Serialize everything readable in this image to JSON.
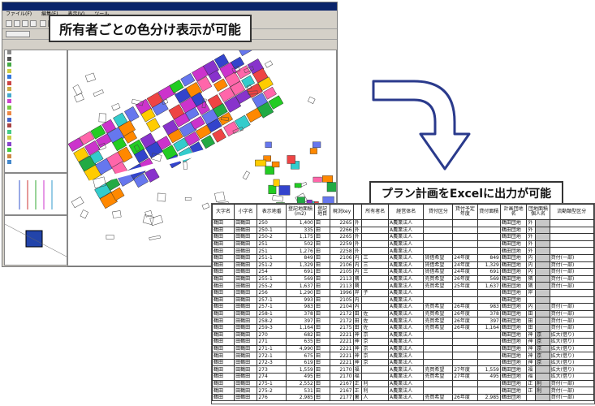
{
  "callouts": {
    "owner_color": "所有者ごとの色分け表示が可能",
    "excel_output": "プラン計画をExcelに出力が可能"
  },
  "gis": {
    "menu": [
      "ファイル(F)",
      "編集(E)",
      "表示(V)",
      "ツール"
    ],
    "colors": {
      "map_fill": [
        "#3344cc",
        "#22aa44",
        "#cc33cc",
        "#ee4444",
        "#ffcc00",
        "#33cccc",
        "#ff8800",
        "#8833cc",
        "#22cc22",
        "#ff66aa",
        "#6677ee"
      ],
      "river": "#ffffff",
      "outline": "#333333"
    }
  },
  "sheet": {
    "headers": [
      "大字名",
      "小字名",
      "表示地番",
      "登記地面積(m2)",
      "登記地目",
      "現況key",
      "所有者名",
      "経営体名",
      "貸付区分",
      "貸付予定年度",
      "貸付面積",
      "計画団地名",
      "団地面積個人名",
      "流動類型区分"
    ],
    "rows": [
      [
        "鶴田",
        "田鶴田",
        "250",
        "1,400",
        "田",
        "2265",
        "外",
        "",
        "A農業法人",
        "",
        "",
        "",
        "鶴田団地",
        "外",
        "",
        ""
      ],
      [
        "鶴田",
        "田鶴田",
        "250-1",
        "335",
        "田",
        "2266",
        "外",
        "",
        "A農業法人",
        "",
        "",
        "",
        "鶴田団地",
        "外",
        "",
        ""
      ],
      [
        "鶴田",
        "田鶴田",
        "250-2",
        "1,175",
        "田",
        "2265",
        "外",
        "",
        "A農業法人",
        "",
        "",
        "",
        "鶴田団地",
        "外",
        "",
        ""
      ],
      [
        "鶴田",
        "田鶴田",
        "251",
        "502",
        "田",
        "2259",
        "外",
        "",
        "A農業法人",
        "",
        "",
        "",
        "鶴田団地",
        "外",
        "",
        ""
      ],
      [
        "鶴田",
        "田鶴田",
        "251",
        "1,276",
        "田",
        "2258",
        "外",
        "",
        "A農業法人",
        "",
        "",
        "",
        "鶴田団地",
        "外",
        "",
        ""
      ],
      [
        "鶴田",
        "田鶴田",
        "251-1",
        "849",
        "田",
        "2106",
        "内",
        "三",
        "A農業法人",
        "賃借希望",
        "24年度",
        "849",
        "鶴田団地",
        "内",
        "",
        "貸付(一部)"
      ],
      [
        "鶴田",
        "田鶴田",
        "251-2",
        "1,329",
        "田",
        "2106",
        "内",
        "三",
        "A農業法人",
        "賃借希望",
        "24年度",
        "1,329",
        "鶴田団地",
        "内",
        "",
        "貸付(一部)"
      ],
      [
        "鶴田",
        "田鶴田",
        "254",
        "691",
        "田",
        "2105",
        "内",
        "三",
        "A農業法人",
        "賃借希望",
        "24年度",
        "691",
        "鶴田団地",
        "内",
        "",
        "貸付(一部)"
      ],
      [
        "鶴田",
        "田鶴田",
        "255-1",
        "569",
        "田",
        "2113",
        "隣",
        "",
        "A農業法人",
        "売買希望",
        "26年度",
        "569",
        "鶴田団地",
        "隣",
        "",
        "貸付(一部)"
      ],
      [
        "鶴田",
        "田鶴田",
        "255-2",
        "1,637",
        "田",
        "2113",
        "隣",
        "",
        "A農業法人",
        "売買希望",
        "25年度",
        "1,637",
        "鶴田団地",
        "隣",
        "",
        "貸付(一部)"
      ],
      [
        "鶴田",
        "田鶴田",
        "256",
        "1,290",
        "田",
        "1996",
        "岸",
        "子",
        "A農業法人",
        "",
        "",
        "",
        "鶴田団地",
        "岸",
        "",
        ""
      ],
      [
        "鶴田",
        "田鶴田",
        "257-1",
        "993",
        "田",
        "2105",
        "内",
        "",
        "A農業法人",
        "",
        "",
        "",
        "鶴田団地",
        "",
        "",
        ""
      ],
      [
        "鶴田",
        "田鶴田",
        "257-1",
        "983",
        "田",
        "2104",
        "内",
        "",
        "A農業法人",
        "売買希望",
        "26年度",
        "983",
        "鶴田団地",
        "内",
        "",
        "貸付(一部)"
      ],
      [
        "鶴田",
        "田鶴田",
        "258-1",
        "378",
        "田",
        "2172",
        "田",
        "佐",
        "A農業法人",
        "売買希望",
        "26年度",
        "378",
        "鶴田団地",
        "田",
        "",
        "貸付(一部)"
      ],
      [
        "鶴田",
        "田鶴田",
        "258-2",
        "397",
        "田",
        "2172",
        "田",
        "佐",
        "A農業法人",
        "売買希望",
        "26年度",
        "397",
        "鶴田団地",
        "田",
        "",
        "貸付(一部)"
      ],
      [
        "鶴田",
        "田鶴田",
        "259-3",
        "1,164",
        "田",
        "2175",
        "田",
        "佐",
        "A農業法人",
        "売買希望",
        "26年度",
        "1,164",
        "鶴田団地",
        "田",
        "",
        "貸付(一部)"
      ],
      [
        "鶴田",
        "田鶴田",
        "270",
        "682",
        "田",
        "2221",
        "神",
        "京",
        "A農業法人",
        "",
        "",
        "",
        "鶴田団地",
        "神",
        "京",
        "拡大(借り)"
      ],
      [
        "鶴田",
        "田鶴田",
        "271",
        "635",
        "田",
        "2221",
        "神",
        "京",
        "A農業法人",
        "",
        "",
        "",
        "鶴田団地",
        "神",
        "京",
        "拡大(借り)"
      ],
      [
        "鶴田",
        "田鶴田",
        "271-1",
        "4,990",
        "田",
        "2221",
        "神",
        "京",
        "A農業法人",
        "",
        "",
        "",
        "鶴田団地",
        "神",
        "京",
        "拡大(借り)"
      ],
      [
        "鶴田",
        "田鶴田",
        "272-1",
        "675",
        "田",
        "2221",
        "神",
        "京",
        "A農業法人",
        "",
        "",
        "",
        "鶴田団地",
        "神",
        "京",
        "拡大(借り)"
      ],
      [
        "鶴田",
        "田鶴田",
        "272-3",
        "619",
        "田",
        "2221",
        "神",
        "京",
        "A農業法人",
        "",
        "",
        "",
        "鶴田団地",
        "神",
        "京",
        "拡大(借り)"
      ],
      [
        "鶴田",
        "田鶴田",
        "273",
        "1,559",
        "田",
        "2170",
        "福",
        "",
        "A農業法人",
        "売買希望",
        "27年度",
        "1,559",
        "鶴田団地",
        "福",
        "",
        "拡大(借り)"
      ],
      [
        "鶴田",
        "田鶴田",
        "274",
        "495",
        "田",
        "2170",
        "福",
        "",
        "A農業法人",
        "売買希望",
        "27年度",
        "495",
        "鶴田団地",
        "福",
        "",
        "拡大(借り)"
      ],
      [
        "鶴田",
        "田鶴田",
        "275-1",
        "2,552",
        "田",
        "2167",
        "正",
        "利",
        "A農業法人",
        "",
        "",
        "",
        "鶴田団地",
        "正",
        "利",
        "貸付(一部)"
      ],
      [
        "鶴田",
        "田鶴田",
        "275-2",
        "531",
        "田",
        "2167",
        "正",
        "利",
        "A農業法人",
        "",
        "",
        "",
        "鶴田団地",
        "正",
        "利",
        "貸付(一部)"
      ],
      [
        "鶴田",
        "田鶴田",
        "276",
        "2,985",
        "田",
        "2177",
        "裏",
        "人",
        "A農業法人",
        "売買希望",
        "26年度",
        "2,985",
        "鶴田団地",
        "",
        "",
        "貸付(一部)"
      ]
    ]
  }
}
